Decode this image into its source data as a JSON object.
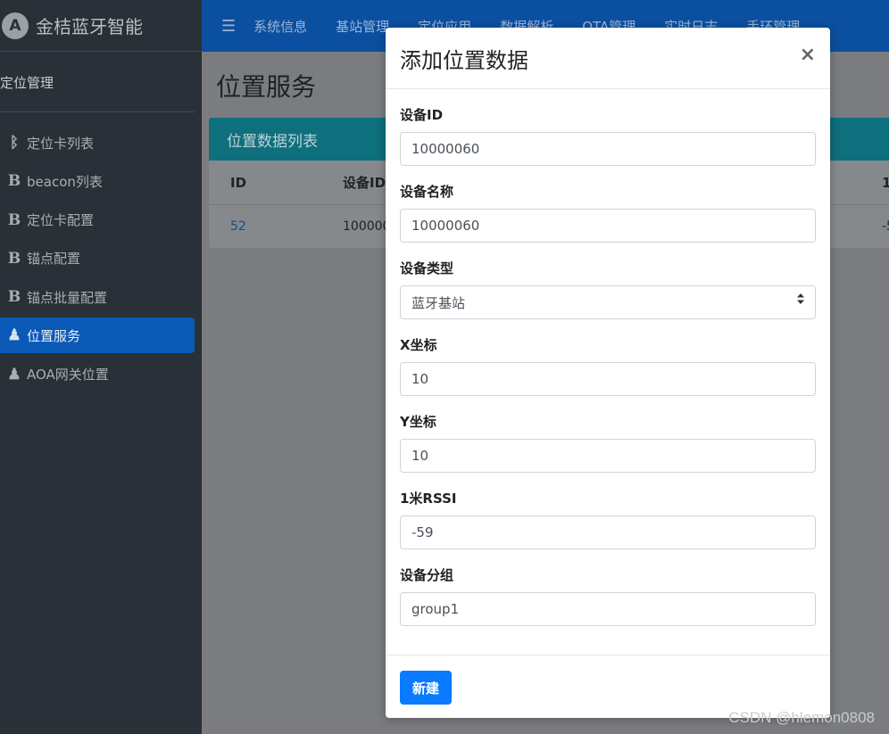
{
  "brand": {
    "name": "金桔蓝牙智能",
    "logo_letter": "A"
  },
  "sidebar": {
    "section_title": "定位管理",
    "items": [
      {
        "label": "定位卡列表",
        "icon": "bluetooth-icon",
        "glyph": "ᛒ"
      },
      {
        "label": "beacon列表",
        "icon": "b-icon",
        "glyph": "B"
      },
      {
        "label": "定位卡配置",
        "icon": "b-icon",
        "glyph": "B"
      },
      {
        "label": "锚点配置",
        "icon": "b-icon",
        "glyph": "B"
      },
      {
        "label": "锚点批量配置",
        "icon": "b-icon",
        "glyph": "B"
      },
      {
        "label": "位置服务",
        "icon": "person-icon",
        "glyph": "♟",
        "active": true
      },
      {
        "label": "AOA网关位置",
        "icon": "person-icon",
        "glyph": "♟"
      }
    ]
  },
  "topbar": {
    "menu_icon": "☰",
    "items": [
      "系统信息",
      "基站管理",
      "定位应用",
      "数据解析",
      "OTA管理",
      "实时日志",
      "手环管理"
    ]
  },
  "main": {
    "page_title": "位置服务",
    "card_title": "位置数据列表",
    "table": {
      "headers": [
        "ID",
        "设备ID",
        "1"
      ],
      "rows": [
        {
          "id": "52",
          "device_id": "100000",
          "last": "-5"
        }
      ]
    }
  },
  "modal": {
    "title": "添加位置数据",
    "close_symbol": "×",
    "fields": {
      "device_id": {
        "label": "设备ID",
        "value": "10000060"
      },
      "device_name": {
        "label": "设备名称",
        "value": "10000060"
      },
      "device_type": {
        "label": "设备类型",
        "value": "蓝牙基站"
      },
      "x": {
        "label": "X坐标",
        "value": "10"
      },
      "y": {
        "label": "Y坐标",
        "value": "10"
      },
      "rssi": {
        "label": "1米RSSI",
        "value": "-59"
      },
      "group": {
        "label": "设备分组",
        "value": "group1"
      }
    },
    "submit_label": "新建"
  },
  "watermark": "CSDN @hlemon0808",
  "colors": {
    "primary_button": "#0a7bff",
    "active_nav": "#0b5ab8",
    "topbar": "#0b4fa0",
    "card_header": "#0e6f7d"
  }
}
